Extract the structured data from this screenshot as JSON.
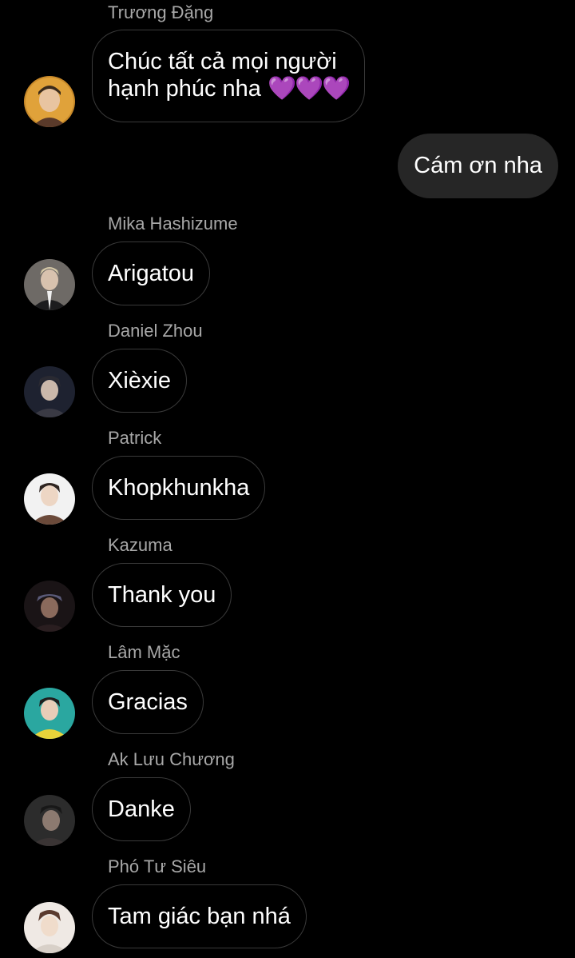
{
  "messages": [
    {
      "sender": "Trương Đặng",
      "line1": "Chúc tất cả mọi người",
      "line2": "hạnh phúc nha",
      "emoji": "💜💜💜"
    },
    {
      "outgoing": "Cám ơn nha"
    },
    {
      "sender": "Mika Hashizume",
      "text": "Arigatou"
    },
    {
      "sender": "Daniel Zhou",
      "text": "Xièxie"
    },
    {
      "sender": "Patrick",
      "text": "Khopkhunkha"
    },
    {
      "sender": "Kazuma",
      "text": "Thank you"
    },
    {
      "sender": "Lâm Mặc",
      "text": "Gracias"
    },
    {
      "sender": "Ak Lưu Chương",
      "text": "Danke"
    },
    {
      "sender": "Phó Tư Siêu",
      "text": "Tam giác bạn nhá"
    }
  ],
  "colors": {
    "background": "#000000",
    "sender_name": "#a8a8a8",
    "bubble_border": "#3a3a3a",
    "outgoing_bubble": "#262626",
    "heart": "#8a2be2"
  },
  "icons": {
    "avatar": "profile-photo"
  }
}
